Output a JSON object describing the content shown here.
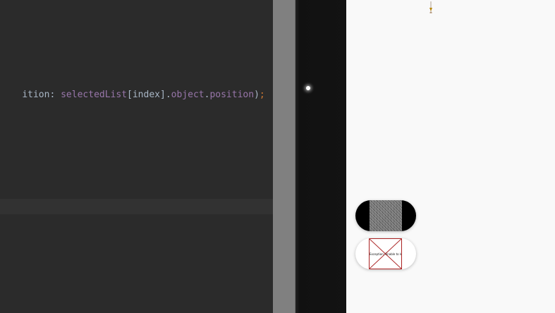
{
  "editor": {
    "code_tokens": [
      {
        "text": "ition",
        "kind": "param"
      },
      {
        "text": ": ",
        "kind": "punct"
      },
      {
        "text": "selectedList",
        "kind": "var"
      },
      {
        "text": "[",
        "kind": "punct"
      },
      {
        "text": "index",
        "kind": "ident"
      },
      {
        "text": "].",
        "kind": "punct"
      },
      {
        "text": "object",
        "kind": "prop"
      },
      {
        "text": ".",
        "kind": "punct"
      },
      {
        "text": "position",
        "kind": "prop"
      },
      {
        "text": ")",
        "kind": "punct"
      },
      {
        "text": ";",
        "kind": "semi"
      }
    ]
  },
  "thumbnails": {
    "missing_image_text": "Exception: Unable to load"
  },
  "icons": {
    "pin": "pin-marker-icon",
    "missing_image": "broken-image-icon"
  },
  "colors": {
    "editor_bg": "#2b2b2b",
    "keyword_purple": "#9876aa",
    "semicolon_orange": "#cc7832",
    "panel_bg": "#f9f9f9"
  }
}
